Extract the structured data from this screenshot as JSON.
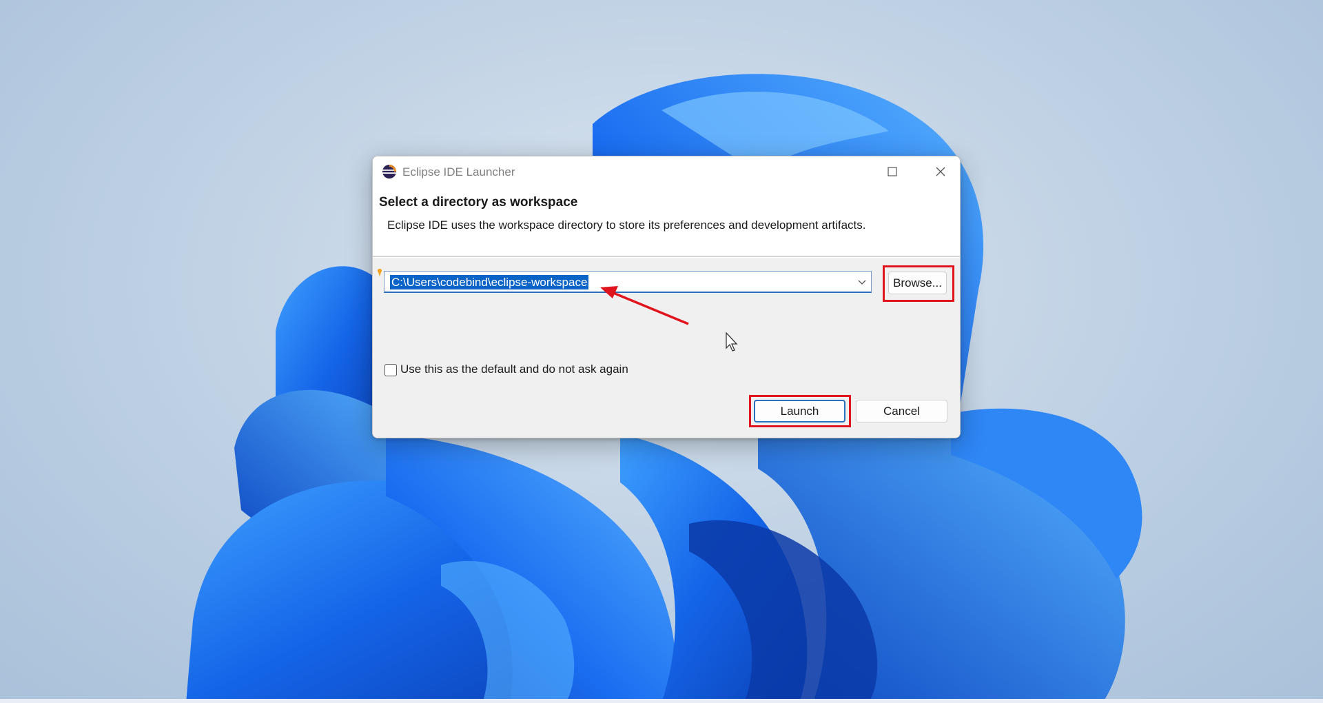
{
  "dialog": {
    "title": "Eclipse IDE Launcher",
    "heading": "Select a directory as workspace",
    "description": "Eclipse IDE uses the workspace directory to store its preferences and development artifacts.",
    "workspace_path": "C:\\Users\\codebind\\eclipse-workspace",
    "browse_label": "Browse...",
    "default_checkbox_label": "Use this as the default and do not ask again",
    "default_checked": false,
    "launch_label": "Launch",
    "cancel_label": "Cancel"
  },
  "annotations": {
    "highlight_color": "#e0141c",
    "arrow_color": "#e0141c"
  },
  "icons": {
    "app": "eclipse-icon",
    "maximize": "maximize-icon",
    "close": "close-icon",
    "dropdown": "chevron-down-icon",
    "cursor": "mouse-pointer-icon"
  }
}
